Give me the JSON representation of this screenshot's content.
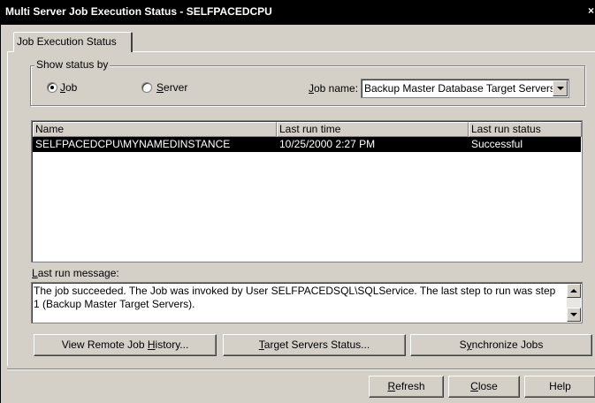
{
  "window": {
    "title": "Multi Server Job Execution Status - SELFPACEDCPU",
    "close_glyph": "×"
  },
  "tabs": [
    {
      "label": "Job Execution Status",
      "selected": true
    }
  ],
  "show_status_by": {
    "legend": "Show status by",
    "job_radio": {
      "prefix": "",
      "mnemonic": "J",
      "rest": "ob",
      "checked": true
    },
    "server_radio": {
      "prefix": "",
      "mnemonic": "S",
      "rest": "erver",
      "checked": false
    },
    "job_name_label": {
      "prefix": "",
      "mnemonic": "J",
      "rest": "ob name:"
    },
    "job_name_value": "Backup Master Database Target Servers"
  },
  "job_list": {
    "columns": [
      "Name",
      "Last run time",
      "Last run status"
    ],
    "rows": [
      {
        "name": "SELFPACEDCPU\\MYNAMEDINSTANCE",
        "last_run_time": "10/25/2000 2:27 PM",
        "last_run_status": "Successful",
        "selected": true
      }
    ]
  },
  "last_run_message": {
    "label": {
      "prefix": "",
      "mnemonic": "L",
      "rest": "ast run message:"
    },
    "text": "The job succeeded.  The Job was invoked by User SELFPACEDSQL\\SQLService.  The last step to run was step 1 (Backup Master Target Servers)."
  },
  "actions": {
    "view_history": {
      "prefix": "View Remote Job ",
      "mnemonic": "H",
      "rest": "istory..."
    },
    "target_status": {
      "prefix": "",
      "mnemonic": "T",
      "rest": "arget Servers Status..."
    },
    "synchronize": {
      "prefix": "S",
      "mnemonic": "y",
      "rest": "nchronize Jobs"
    }
  },
  "footer": {
    "refresh": {
      "prefix": "",
      "mnemonic": "R",
      "rest": "efresh"
    },
    "close": {
      "prefix": "",
      "mnemonic": "C",
      "rest": "lose"
    },
    "help": "Help"
  },
  "colors": {
    "dialog_bg": "#d4d0c8",
    "titlebar_bg": "#000000",
    "selection_bg": "#000000",
    "selection_fg": "#ffffff"
  }
}
